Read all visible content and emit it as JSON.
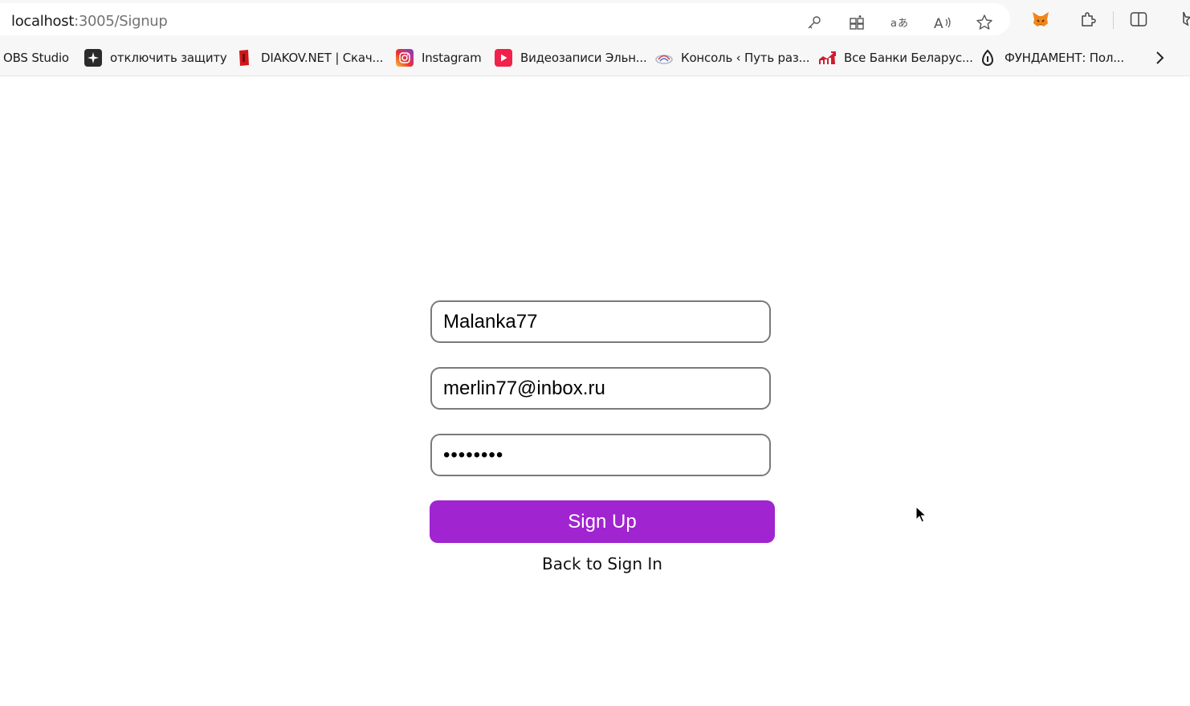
{
  "browser": {
    "url_host": "localhost",
    "url_path": ":3005/Signup",
    "toolbar_icons": [
      "key-icon",
      "apps-icon",
      "translate-icon",
      "read-aloud-icon",
      "favorite-star-icon",
      "metamask-fox-icon",
      "extensions-puzzle-icon",
      "split-screen-icon",
      "favorites-icon"
    ]
  },
  "bookmarks": [
    {
      "label": "OBS Studio",
      "icon": "none"
    },
    {
      "label": "отключить защиту",
      "icon": "sparkle-icon"
    },
    {
      "label": "DIAKOV.NET | Скач...",
      "icon": "diakov-icon"
    },
    {
      "label": "Instagram",
      "icon": "instagram-icon"
    },
    {
      "label": "Видеозаписи Эльн...",
      "icon": "video-play-icon"
    },
    {
      "label": "Консоль ‹ Путь раз...",
      "icon": "wp-console-icon"
    },
    {
      "label": "Все Банки Беларус...",
      "icon": "banks-chart-icon"
    },
    {
      "label": "ФУНДАМЕНТ: Пол...",
      "icon": "fundament-icon"
    }
  ],
  "form": {
    "username_value": "Malanka77",
    "email_value": "merlin77@inbox.ru",
    "password_value": "••••••••",
    "submit_label": "Sign Up",
    "back_link": "Back to Sign In"
  },
  "colors": {
    "accent": "#a024d0",
    "field_border": "#7a7a7a"
  }
}
